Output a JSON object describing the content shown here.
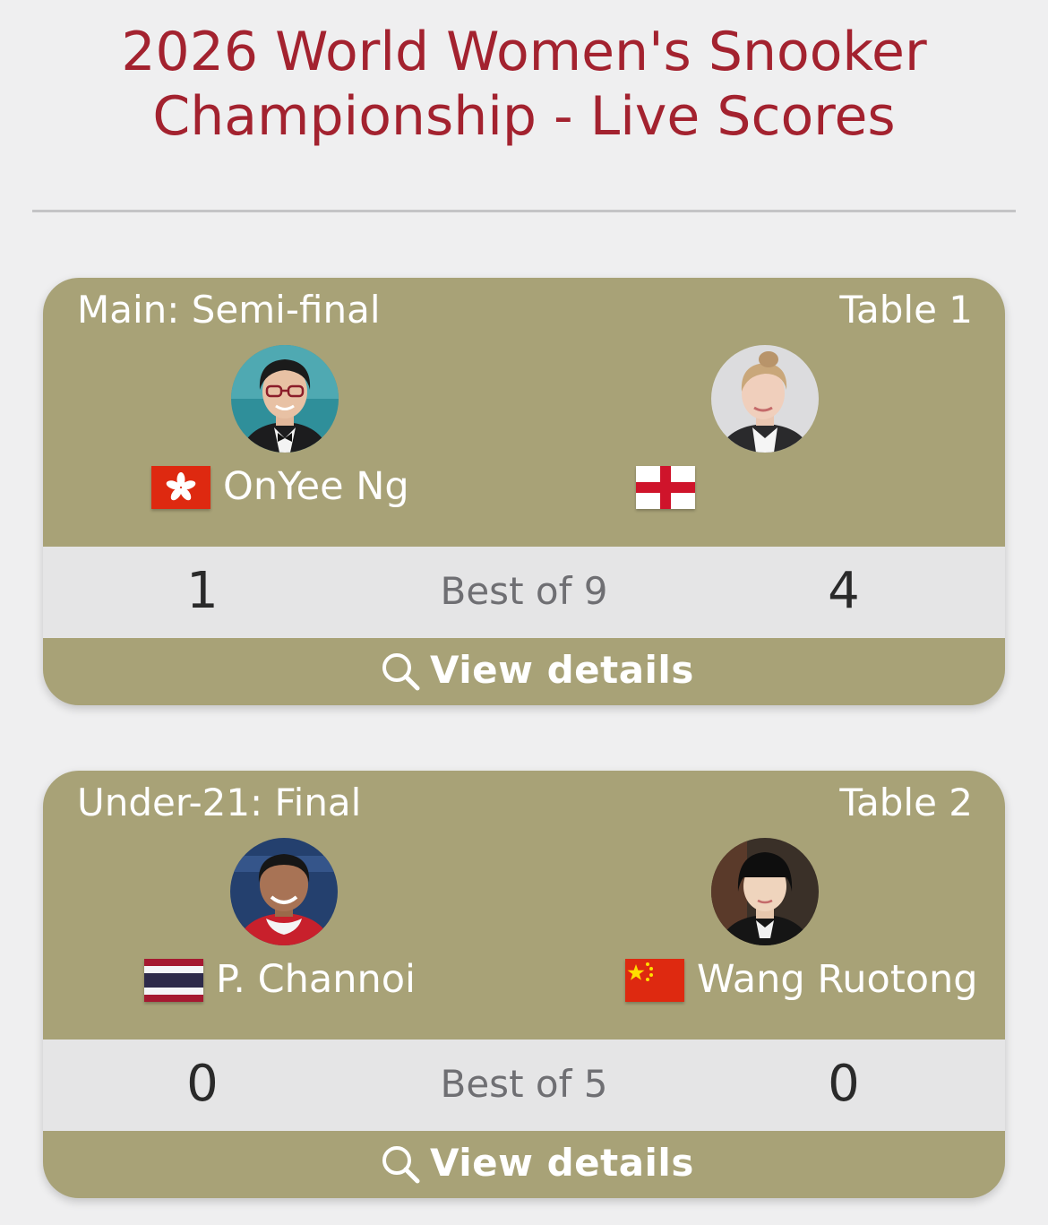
{
  "page": {
    "title_line1": "2026 World Women's Snooker",
    "title_line2": "Championship - Live Scores",
    "accent_color": "#a3222f",
    "card_color": "#a8a277"
  },
  "matches": [
    {
      "round": "Main: Semi-final",
      "table": "Table 1",
      "best_of": "Best of 9",
      "view_details": "View details",
      "player1": {
        "name": "OnYee Ng",
        "flag": "hong-kong-flag",
        "score": "1"
      },
      "player2": {
        "name": "",
        "flag": "england-flag",
        "score": "4"
      }
    },
    {
      "round": "Under-21: Final",
      "table": "Table 2",
      "best_of": "Best of 5",
      "view_details": "View details",
      "player1": {
        "name": "P. Channoi",
        "flag": "thailand-flag",
        "score": "0"
      },
      "player2": {
        "name": "Wang Ruotong",
        "flag": "china-flag",
        "score": "0"
      }
    }
  ]
}
